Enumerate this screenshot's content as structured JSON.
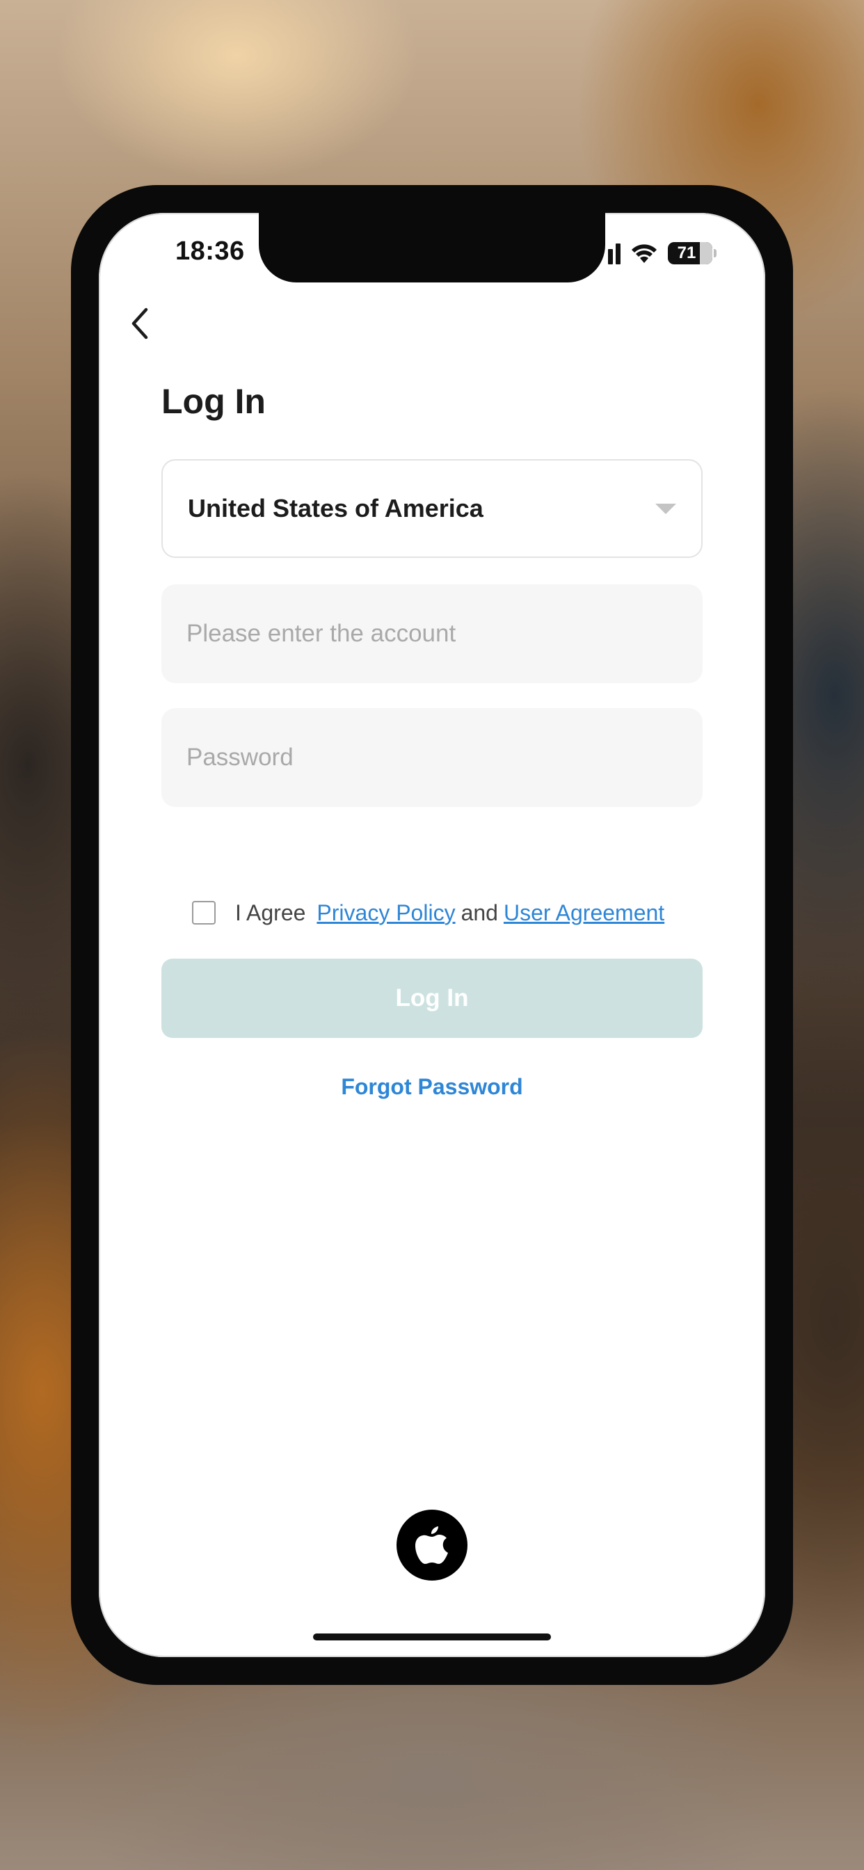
{
  "status_bar": {
    "time": "18:36",
    "battery": "71"
  },
  "header": {
    "back_icon": "chevron-left-icon",
    "title": "Log In"
  },
  "form": {
    "country": {
      "value": "United States of America",
      "icon": "chevron-down-icon"
    },
    "account": {
      "value": "",
      "placeholder": "Please enter the account"
    },
    "password": {
      "value": "",
      "placeholder": "Password"
    },
    "agreement": {
      "checked": false,
      "prefix": "I Agree",
      "privacy_link": "Privacy Policy",
      "conjunction": "and",
      "user_agreement_link": "User Agreement"
    },
    "login_button": "Log In",
    "forgot_password": "Forgot Password"
  },
  "third_party": {
    "apple_icon": "apple-logo-icon"
  },
  "colors": {
    "accent_link": "#2e86d6",
    "login_button_disabled": "#cde2e0",
    "field_background": "#f6f6f6"
  }
}
